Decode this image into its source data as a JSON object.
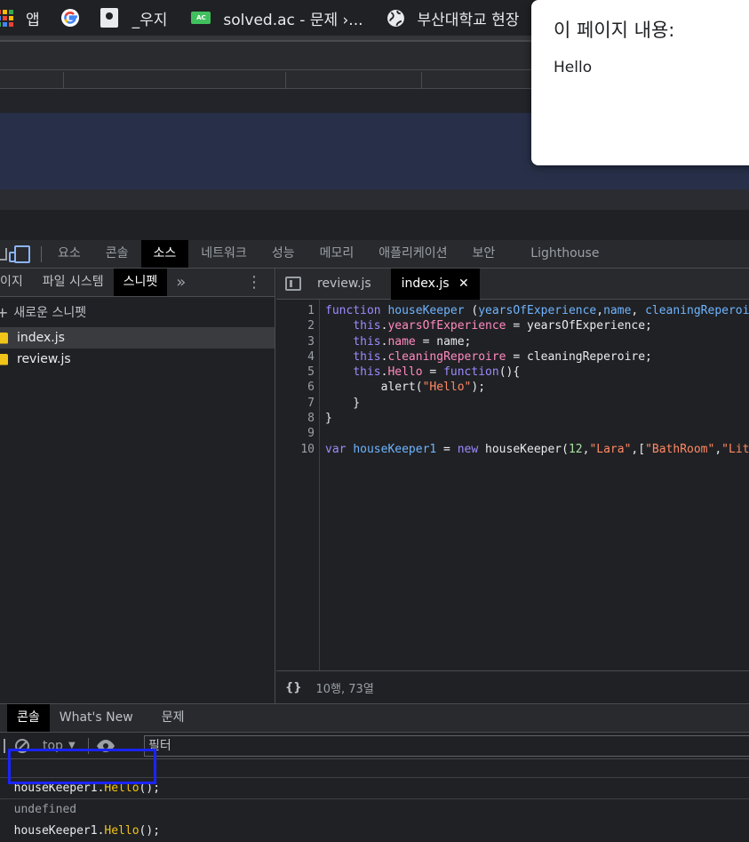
{
  "bookmarks": [
    {
      "label": "앱",
      "icon": "apps-grid-icon"
    },
    {
      "label": "",
      "icon": "google-icon"
    },
    {
      "label": "_우지",
      "icon": "bookmark-page-icon"
    },
    {
      "label": "solved.ac - 문제 ›...",
      "icon": "solvedac-icon"
    },
    {
      "label": "부산대학교 현장",
      "icon": "globe-icon"
    }
  ],
  "alert": {
    "title": "이 페이지 내용:",
    "message": "Hello"
  },
  "devtools": {
    "tabs": [
      "요소",
      "콘솔",
      "소스",
      "네트워크",
      "성능",
      "메모리",
      "애플리케이션",
      "보안",
      "Lighthouse"
    ],
    "active_tab": "소스"
  },
  "navigator": {
    "tabs": [
      "이지",
      "파일 시스템",
      "스니펫"
    ],
    "active_tab": "스니펫",
    "new_snippet": "새로운 스니펫",
    "files": [
      "index.js",
      "review.js"
    ],
    "selected_file": "index.js"
  },
  "editor": {
    "tabs": [
      "review.js",
      "index.js"
    ],
    "active_tab": "index.js",
    "line_numbers": [
      "1",
      "2",
      "3",
      "4",
      "5",
      "6",
      "7",
      "8",
      "9",
      "10"
    ],
    "status": "10행, 73열",
    "format_icon": "{}"
  },
  "drawer": {
    "tabs": [
      "콘솔",
      "What's New",
      "문제"
    ],
    "active_tab": "콘솔",
    "context": "top",
    "filter_placeholder": "필터"
  },
  "console": {
    "entries": [
      {
        "type": "input",
        "text": "houseKeeper1.Hello();"
      },
      {
        "type": "output",
        "text": "undefined"
      },
      {
        "type": "input",
        "text": "houseKeeper1.Hello();"
      }
    ]
  },
  "colors": {
    "highlight_box": "#1a24ff",
    "active_tab_bg": "#000000",
    "js_icon": "#f0c419"
  }
}
